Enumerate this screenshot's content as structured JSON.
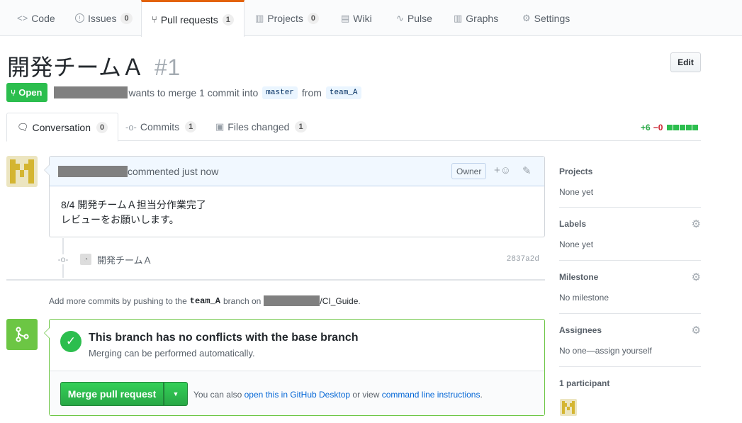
{
  "repo_nav": {
    "tabs": [
      {
        "label": "Code",
        "icon": "code-icon",
        "glyph": "<>"
      },
      {
        "label": "Issues",
        "count": "0",
        "icon": "issue-icon",
        "glyph": "!"
      },
      {
        "label": "Pull requests",
        "count": "1",
        "icon": "pull-request-icon",
        "glyph": "⑂"
      },
      {
        "label": "Projects",
        "count": "0",
        "icon": "project-icon",
        "glyph": "▥"
      },
      {
        "label": "Wiki",
        "icon": "wiki-icon",
        "glyph": "▤"
      },
      {
        "label": "Pulse",
        "icon": "pulse-icon",
        "glyph": "∿"
      },
      {
        "label": "Graphs",
        "icon": "graph-icon",
        "glyph": "▥"
      },
      {
        "label": "Settings",
        "icon": "gear-icon",
        "glyph": "⚙"
      }
    ],
    "selected": "Pull requests"
  },
  "pr": {
    "title": "開発チームＡ",
    "number": "#1",
    "edit_label": "Edit",
    "state": "Open",
    "state_icon": "pull-request-icon",
    "merge_text_1": "wants to merge 1 commit into",
    "base_branch": "master",
    "merge_text_2": "from",
    "head_branch": "team_A"
  },
  "pr_tabs": [
    {
      "label": "Conversation",
      "count": "0",
      "icon": "comment-icon"
    },
    {
      "label": "Commits",
      "count": "1",
      "icon": "commit-icon"
    },
    {
      "label": "Files changed",
      "count": "1",
      "icon": "file-diff-icon"
    }
  ],
  "diffstat": {
    "additions": "+6",
    "deletions": "−0",
    "blocks": 5
  },
  "comment": {
    "header_text": "commented just now",
    "owner_label": "Owner",
    "body_lines": [
      "8/4 開発チームＡ担当分作業完了",
      "レビューをお願いします。"
    ]
  },
  "commit": {
    "message": "開発チームＡ",
    "sha": "2837a2d"
  },
  "hint": {
    "prefix": "Add more commits by pushing to the",
    "branch": "team_A",
    "middle": "branch on",
    "repo": "/CI_Guide",
    "suffix": "."
  },
  "merge": {
    "title": "This branch has no conflicts with the base branch",
    "subtitle": "Merging can be performed automatically.",
    "button_label": "Merge pull request",
    "alt_prefix": "You can also",
    "alt_link1": "open this in GitHub Desktop",
    "alt_middle": "or view",
    "alt_link2": "command line instructions",
    "alt_suffix": "."
  },
  "sidebar": {
    "projects": {
      "label": "Projects",
      "value": "None yet"
    },
    "labels": {
      "label": "Labels",
      "value": "None yet"
    },
    "milestone": {
      "label": "Milestone",
      "value": "No milestone"
    },
    "assignees": {
      "label": "Assignees",
      "value": "No one—assign yourself"
    },
    "participants": {
      "label": "1 participant"
    }
  },
  "colors": {
    "accent": "#e36209",
    "open": "#2cbe4e",
    "merge": "#6cc644",
    "link": "#0366d6"
  }
}
